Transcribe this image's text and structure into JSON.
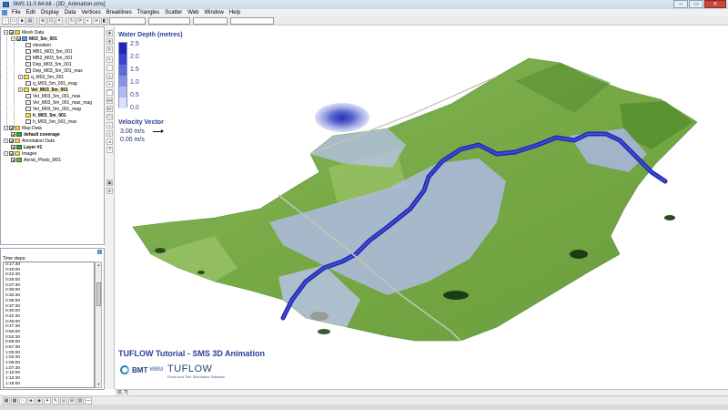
{
  "window": {
    "title": "SMS 11.0 64-bit - [3D_Animation.sms]",
    "controls": [
      "–",
      "▭",
      "✕"
    ]
  },
  "menu": [
    "File",
    "Edit",
    "Display",
    "Data",
    "Vertices",
    "Breaklines",
    "Triangles",
    "Scatter",
    "Web",
    "Window",
    "Help"
  ],
  "tree": [
    {
      "label": "Mesh Data",
      "icon": "folder",
      "level": 0,
      "expanded": true,
      "checked": true,
      "bold": false
    },
    {
      "label": "M03_5m_001",
      "icon": "mesh",
      "level": 1,
      "expanded": true,
      "checked": true,
      "bold": true
    },
    {
      "label": "elevation",
      "icon": "scalar",
      "level": 2,
      "checked": false,
      "bold": false
    },
    {
      "label": "MB1_M03_5m_001",
      "icon": "scalar",
      "level": 2,
      "checked": false,
      "bold": false
    },
    {
      "label": "MB2_M03_5m_001",
      "icon": "scalar",
      "level": 2,
      "checked": false,
      "bold": false
    },
    {
      "label": "Dep_M03_5m_001",
      "icon": "scalar",
      "level": 2,
      "checked": false,
      "bold": false
    },
    {
      "label": "Dep_M03_5m_001_max",
      "icon": "scalar",
      "level": 2,
      "checked": false,
      "bold": false
    },
    {
      "label": "q_M03_5m_001",
      "icon": "vector",
      "level": 2,
      "expanded": false,
      "checked": false,
      "bold": false
    },
    {
      "label": "q_M03_5m_001_mag",
      "icon": "scalar",
      "level": 2,
      "checked": false,
      "bold": false
    },
    {
      "label": "Vel_M03_5m_001",
      "icon": "vector",
      "level": 2,
      "expanded": false,
      "checked": true,
      "bold": true,
      "selected": true
    },
    {
      "label": "Vel_M03_5m_001_max",
      "icon": "scalar",
      "level": 2,
      "checked": false,
      "bold": false
    },
    {
      "label": "Vel_M03_5m_001_max_mag",
      "icon": "scalar",
      "level": 2,
      "checked": false,
      "bold": false
    },
    {
      "label": "Vel_M03_5m_001_mag",
      "icon": "scalar",
      "level": 2,
      "checked": false,
      "bold": false
    },
    {
      "label": "h_M03_5m_001",
      "icon": "vector",
      "level": 2,
      "checked": false,
      "bold": true
    },
    {
      "label": "h_M03_5m_001_max",
      "icon": "scalar",
      "level": 2,
      "checked": false,
      "bold": false
    },
    {
      "label": "Map Data",
      "icon": "folder",
      "level": 0,
      "expanded": true,
      "checked": true,
      "bold": false
    },
    {
      "label": "default coverage",
      "icon": "cover",
      "level": 1,
      "checked": true,
      "bold": true
    },
    {
      "label": "Annotation Data",
      "icon": "folder",
      "level": 0,
      "expanded": true,
      "checked": true,
      "bold": false
    },
    {
      "label": "Layer #1",
      "icon": "cover",
      "level": 1,
      "checked": true,
      "bold": true
    },
    {
      "label": "Images",
      "icon": "folder",
      "level": 0,
      "expanded": true,
      "checked": true,
      "bold": false
    },
    {
      "label": "Aerial_Photo_M01",
      "icon": "photo",
      "level": 1,
      "checked": true,
      "bold": false
    }
  ],
  "time_panel": {
    "title": "Time steps:",
    "steps": [
      "0:17:30",
      "0:20:00",
      "0:22:30",
      "0:25:00",
      "0:27:30",
      "0:30:00",
      "0:32:30",
      "0:35:00",
      "0:37:30",
      "0:40:00",
      "0:42:30",
      "0:45:00",
      "0:47:30",
      "0:50:00",
      "0:52:30",
      "0:55:00",
      "0:57:30",
      "1:00:00",
      "1:02:30",
      "1:05:00",
      "1:07:30",
      "1:10:00",
      "1:12:30",
      "1:15:00",
      "1:17:30"
    ],
    "selected_index": 24
  },
  "legend": {
    "title": "Water Depth (metres)",
    "labels": [
      "2.5",
      "2.0",
      "1.5",
      "1.0",
      "0.5",
      "0.0"
    ],
    "colors": [
      "#1e25b8",
      "#3a46c9",
      "#5c6bd6",
      "#8793e2",
      "#b1b9ee",
      "#dde1f8"
    ],
    "vector_title": "Velocity Vector",
    "vector_max": "3.00 m/s",
    "vector_min": "0.00 m/s"
  },
  "branding": {
    "tutorial_title": "TUFLOW Tutorial - SMS 3D Animation",
    "bmt": "BMT",
    "bmt_sub": "WBM",
    "tuflow": "TUFLOW",
    "tuflow_tag": "Flood and Tide Simulation Software"
  },
  "status": {
    "coords": "(0, ?)"
  },
  "colors": {
    "accent": "#2a3e9b",
    "terrain": "#7fb04a",
    "water_deep": "#1e25b8",
    "selection": "#3879d9"
  }
}
